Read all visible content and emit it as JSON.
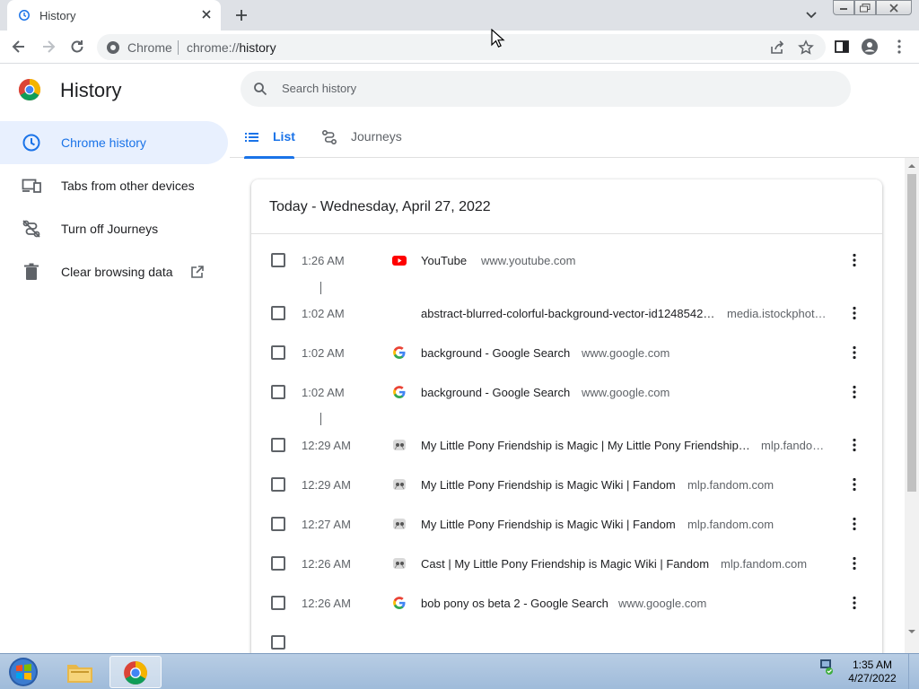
{
  "browser": {
    "tab_title": "History",
    "omnibox_origin": "Chrome",
    "omnibox_url_scheme": "chrome://",
    "omnibox_url_path": "history"
  },
  "page": {
    "title": "History",
    "search_placeholder": "Search history",
    "sidebar": [
      {
        "label": "Chrome history",
        "icon": "clock-icon",
        "active": true
      },
      {
        "label": "Tabs from other devices",
        "icon": "devices-icon",
        "active": false
      },
      {
        "label": "Turn off Journeys",
        "icon": "journeys-off-icon",
        "active": false
      },
      {
        "label": "Clear browsing data",
        "icon": "trash-icon",
        "active": false
      }
    ],
    "tabs": [
      {
        "label": "List",
        "active": true
      },
      {
        "label": "Journeys",
        "active": false
      }
    ],
    "date_header": "Today - Wednesday, April 27, 2022",
    "entries": [
      {
        "time": "1:26 AM",
        "title": "YouTube",
        "domain": "www.youtube.com",
        "favicon": "youtube-icon"
      },
      {
        "time": "1:02 AM",
        "title": "abstract-blurred-colorful-background-vector-id1248542…",
        "domain": "media.istockphot…",
        "favicon": "none"
      },
      {
        "time": "1:02 AM",
        "title": "background - Google Search",
        "domain": "www.google.com",
        "favicon": "google-icon"
      },
      {
        "time": "1:02 AM",
        "title": "background - Google Search",
        "domain": "www.google.com",
        "favicon": "google-icon"
      },
      {
        "time": "12:29 AM",
        "title": "My Little Pony Friendship is Magic | My Little Pony Friendship…",
        "domain": "mlp.fando…",
        "favicon": "fandom-icon"
      },
      {
        "time": "12:29 AM",
        "title": "My Little Pony Friendship is Magic Wiki | Fandom",
        "domain": "mlp.fandom.com",
        "favicon": "fandom-icon"
      },
      {
        "time": "12:27 AM",
        "title": "My Little Pony Friendship is Magic Wiki | Fandom",
        "domain": "mlp.fandom.com",
        "favicon": "fandom-icon"
      },
      {
        "time": "12:26 AM",
        "title": "Cast | My Little Pony Friendship is Magic Wiki | Fandom",
        "domain": "mlp.fandom.com",
        "favicon": "fandom-icon"
      },
      {
        "time": "12:26 AM",
        "title": "bob pony os beta 2 - Google Search",
        "domain": "www.google.com",
        "favicon": "google-icon"
      }
    ]
  },
  "taskbar": {
    "time": "1:35 AM",
    "date": "4/27/2022"
  },
  "colors": {
    "accent": "#1a73e8",
    "active_nav_bg": "#e8f0fe",
    "tabstrip_bg": "#dee1e6",
    "taskbar_bg": "#a9c2de"
  }
}
